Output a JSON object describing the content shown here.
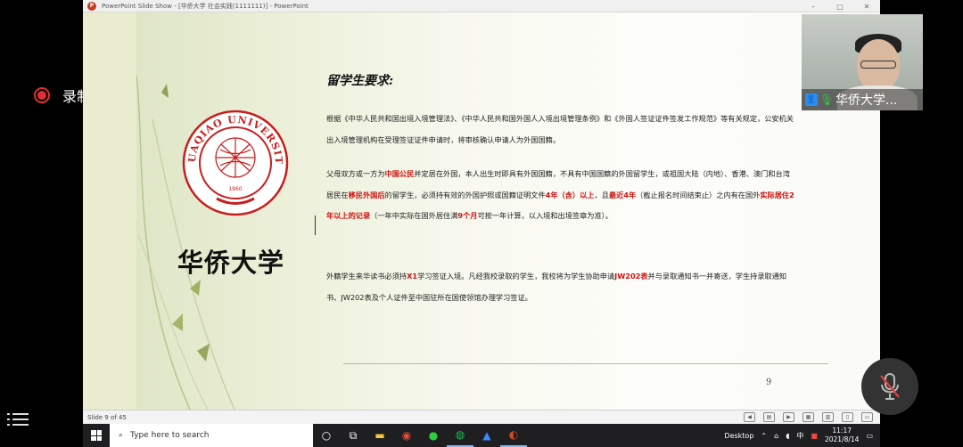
{
  "recording": {
    "label": "录制中"
  },
  "window": {
    "title": "PowerPoint Slide Show - [华侨大学 社会实践(1111111)] - PowerPoint",
    "controls": [
      "–",
      "▢",
      "✕"
    ]
  },
  "slide": {
    "title": "留学生要求:",
    "university_name": "华侨大学",
    "logo_text": "HUAQIAO UNIVERSITY",
    "logo_year": "1960",
    "para1": "根据《中华人民共和国出境入境管理法》、《中华人民共和国外国人入境出境管理条例》和《外国人签证证件签发工作规范》等有关规定，公安机关出入境管理机构在受理签证证件申请时，将审核确认申请人为外国国籍。",
    "para2": [
      {
        "t": "父母双方或一方为",
        "red": false
      },
      {
        "t": "中国公民",
        "red": true
      },
      {
        "t": "并定居在外国，本人出生时即具有外国国籍，不具有中国国籍的外国留学生，或祖国大陆（内地）、香港、澳门和台湾居民在",
        "red": false
      },
      {
        "t": "移民外国后",
        "red": true
      },
      {
        "t": "的留学生，必须持有效的外国护照或国籍证明文件",
        "red": false
      },
      {
        "t": "4年（含）以上",
        "red": true
      },
      {
        "t": "，且",
        "red": false
      },
      {
        "t": "最近4年",
        "red": true
      },
      {
        "t": "（截止报名时间结束止）之内有在国外",
        "red": false
      },
      {
        "t": "实际居住2年以上的记录",
        "red": true
      },
      {
        "t": "（一年中实际在国外居住满",
        "red": false
      },
      {
        "t": "9个月",
        "red": true
      },
      {
        "t": "可按一年计算，以入境和出境签章为准）。",
        "red": false
      }
    ],
    "para3": [
      {
        "t": "外籍学生来华读书必须持",
        "red": false
      },
      {
        "t": "X1",
        "red": true
      },
      {
        "t": "学习签证入境。凡经我校录取的学生，我校将为学生协助申请",
        "red": false
      },
      {
        "t": "JW202表",
        "red": true
      },
      {
        "t": "并与录取通知书一并寄送，学生持录取通知书、JW202表及个人证件至中国驻所在国使领馆办理学习签证。",
        "red": false
      }
    ],
    "page_number": "9"
  },
  "statusbar": {
    "slide_count": "Slide 9 of 45"
  },
  "video": {
    "participant_label": "华侨大学..."
  },
  "taskbar": {
    "search_placeholder": "Type here to search",
    "desktop_label": "Desktop",
    "ime": "中",
    "time": "11:17",
    "date": "2021/8/14"
  },
  "colors": {
    "accent_red": "#d01010",
    "logo_red": "#c81e1e",
    "taskbar": "#1f1f22"
  }
}
